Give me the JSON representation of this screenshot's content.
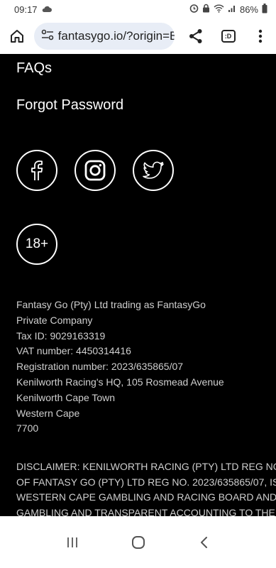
{
  "status_bar": {
    "time": "09:17",
    "battery": "86%",
    "icons": [
      "cloud-icon",
      "alarm-icon",
      "lock-icon",
      "wifi-icon",
      "signal-icon",
      "battery-icon"
    ]
  },
  "browser": {
    "url": "fantasygo.io/?origin=B",
    "tabs_label": ":D"
  },
  "footer": {
    "links": {
      "faqs": "FAQs",
      "forgot_password": "Forgot Password"
    },
    "social": [
      "facebook-icon",
      "instagram-icon",
      "twitter-icon"
    ],
    "age_badge": "18+",
    "company": [
      "Fantasy Go (Pty) Ltd trading as FantasyGo",
      "Private Company",
      "Tax ID: 9029163319",
      "VAT number: 4450314416",
      "Registration number: 2023/635865/07",
      "Kenilworth Racing's HQ, 105 Rosmead Avenue",
      "Kenilworth Cape Town",
      "Western Cape",
      "7700"
    ],
    "disclaimer": [
      "DISCLAIMER: KENILWORTH RACING (PTY) LTD REG NO. 2",
      "OF FANTASY GO (PTY) LTD REG NO. 2023/635865/07, IS",
      "WESTERN CAPE GAMBLING AND RACING BOARD AND S",
      "GAMBLING AND TRANSPARENT ACCOUNTING TO THE S"
    ]
  },
  "nav_bar": [
    "recents-icon",
    "home-icon",
    "back-icon"
  ],
  "colors": {
    "background": "#000000",
    "text": "#ffffff",
    "muted_text": "#cfcfcf",
    "url_pill": "#e8edf6"
  }
}
